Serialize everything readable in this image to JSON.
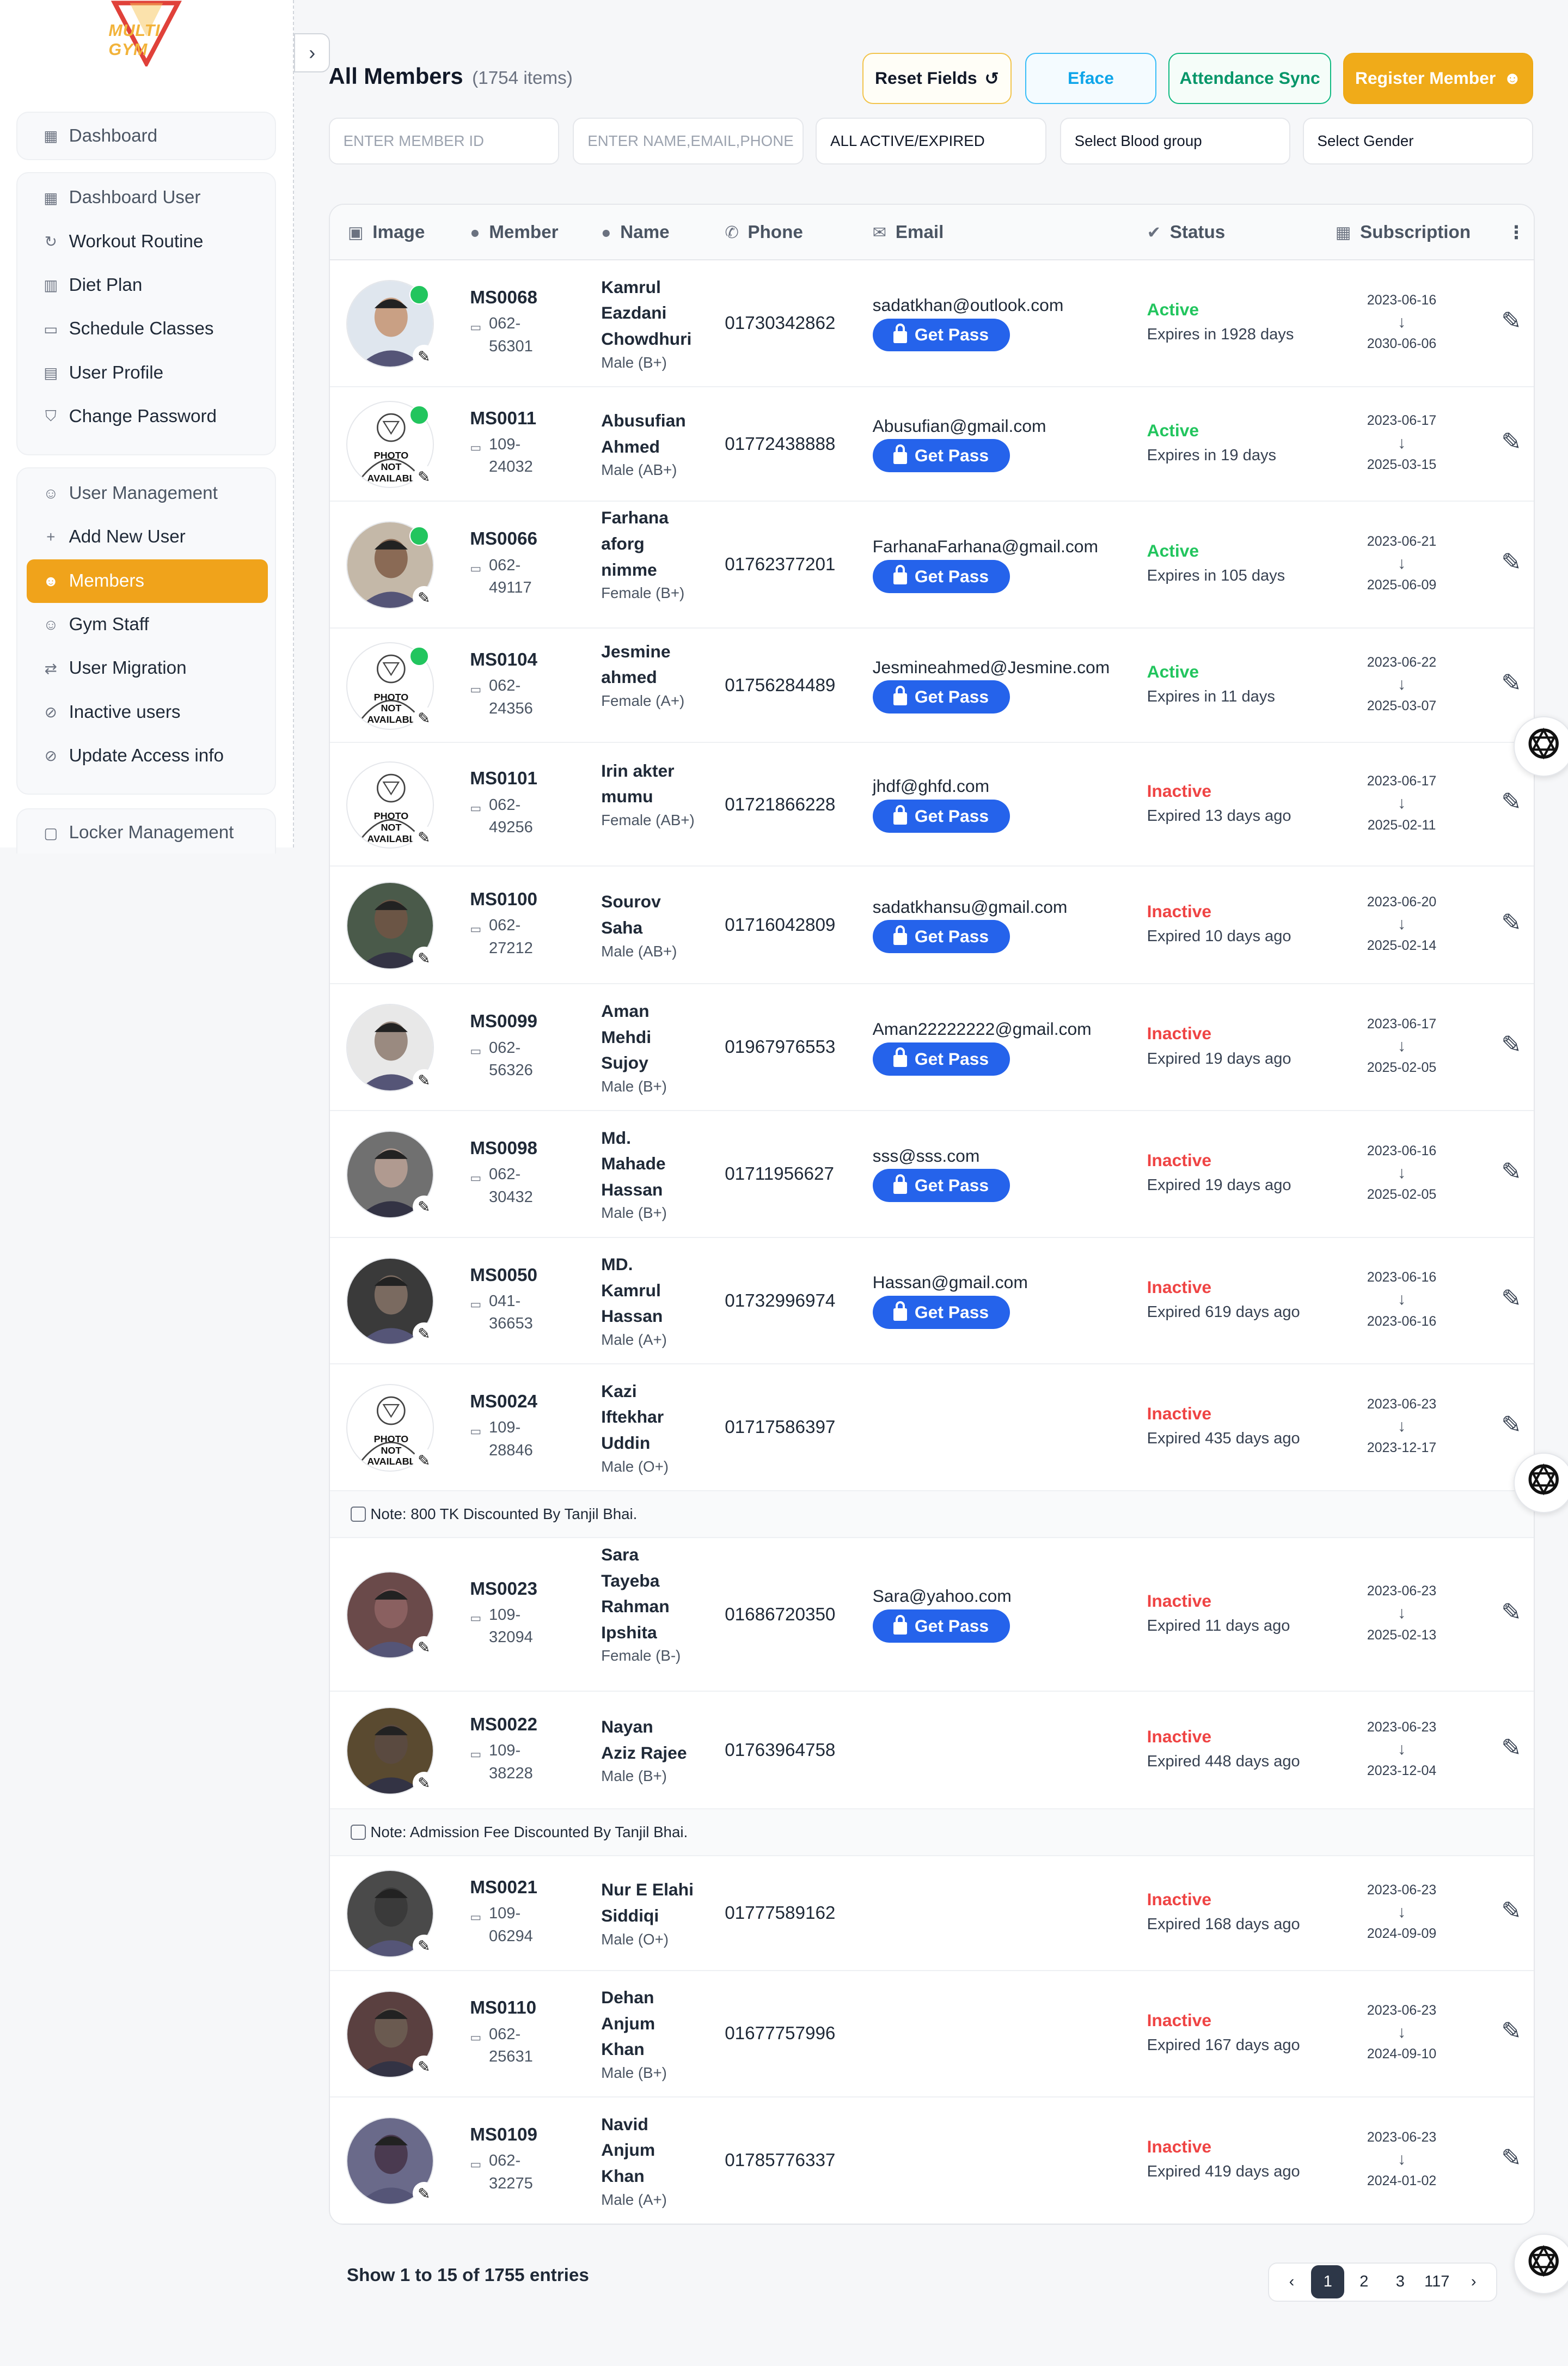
{
  "brand": {
    "logo_text": "MULTI GYM"
  },
  "sidebar": {
    "dashboard": "Dashboard",
    "group1": [
      "Dashboard User",
      "Workout Routine",
      "Diet Plan",
      "Schedule Classes",
      "User Profile",
      "Change Password"
    ],
    "group2": [
      "User Management",
      "Add New User",
      "Members",
      "Gym Staff",
      "User Migration",
      "Inactive users",
      "Update Access info"
    ],
    "locker": "Locker Management"
  },
  "header": {
    "title": "All Members",
    "count": "(1754 items)",
    "reset": "Reset Fields",
    "eface": "Eface",
    "sync": "Attendance Sync",
    "register": "Register Member"
  },
  "filters": {
    "member_id": "ENTER MEMBER ID",
    "name": "ENTER NAME,EMAIL,PHONE",
    "status": "ALL ACTIVE/EXPIRED",
    "blood": "Select Blood group",
    "gender": "Select Gender"
  },
  "columns": [
    "Image",
    "Member",
    "Name",
    "Phone",
    "Email",
    "Status",
    "Subscription"
  ],
  "get_pass_label": "Get Pass",
  "photo_na": [
    "PHOTO",
    "NOT",
    "AVAILABL"
  ],
  "rows": [
    {
      "id": "MS0068",
      "card1": "062-",
      "card2": "56301",
      "name": [
        "Kamrul",
        "Eazdani",
        "Chowdhuri"
      ],
      "gender": "Male (B+)",
      "phone": "01730342862",
      "email": "sadatkhan@outlook.com",
      "status": "Active",
      "expiry": "Expires in 1928 days",
      "start": "2023-06-16",
      "end": "2030-06-06"
    },
    {
      "id": "MS0011",
      "card1": "109-",
      "card2": "24032",
      "name": [
        "Abusufian",
        "Ahmed"
      ],
      "gender": "Male (AB+)",
      "phone": "01772438888",
      "email": "Abusufian@gmail.com",
      "status": "Active",
      "expiry": "Expires in 19 days",
      "start": "2023-06-17",
      "end": "2025-03-15"
    },
    {
      "id": "MS0066",
      "card1": "062-",
      "card2": "49117",
      "name": [
        "Farhana",
        "aforg",
        "nimme"
      ],
      "gender": "Female (B+)",
      "phone": "01762377201",
      "email": "FarhanaFarhana@gmail.com",
      "status": "Active",
      "expiry": "Expires in 105 days",
      "start": "2023-06-21",
      "end": "2025-06-09"
    },
    {
      "id": "MS0104",
      "card1": "062-",
      "card2": "24356",
      "name": [
        "Jesmine",
        "ahmed"
      ],
      "gender": "Female (A+)",
      "phone": "01756284489",
      "email": "Jesmineahmed@Jesmine.com",
      "status": "Active",
      "expiry": "Expires in 11 days",
      "start": "2023-06-22",
      "end": "2025-03-07"
    },
    {
      "id": "MS0101",
      "card1": "062-",
      "card2": "49256",
      "name": [
        "Irin akter",
        "mumu"
      ],
      "gender": "Female (AB+)",
      "phone": "01721866228",
      "email": "jhdf@ghfd.com",
      "status": "Inactive",
      "expiry": "Expired 13 days ago",
      "start": "2023-06-17",
      "end": "2025-02-11"
    },
    {
      "id": "MS0100",
      "card1": "062-",
      "card2": "27212",
      "name": [
        "Sourov",
        "Saha"
      ],
      "gender": "Male (AB+)",
      "phone": "01716042809",
      "email": "sadatkhansu@gmail.com",
      "status": "Inactive",
      "expiry": "Expired 10 days ago",
      "start": "2023-06-20",
      "end": "2025-02-14"
    },
    {
      "id": "MS0099",
      "card1": "062-",
      "card2": "56326",
      "name": [
        "Aman",
        "Mehdi",
        "Sujoy"
      ],
      "gender": "Male (B+)",
      "phone": "01967976553",
      "email": "Aman22222222@gmail.com",
      "status": "Inactive",
      "expiry": "Expired 19 days ago",
      "start": "2023-06-17",
      "end": "2025-02-05"
    },
    {
      "id": "MS0098",
      "card1": "062-",
      "card2": "30432",
      "name": [
        "Md.",
        "Mahade",
        "Hassan"
      ],
      "gender": "Male (B+)",
      "phone": "01711956627",
      "email": "sss@sss.com",
      "status": "Inactive",
      "expiry": "Expired 19 days ago",
      "start": "2023-06-16",
      "end": "2025-02-05"
    },
    {
      "id": "MS0050",
      "card1": "041-",
      "card2": "36653",
      "name": [
        "MD.",
        "Kamrul",
        "Hassan"
      ],
      "gender": "Male (A+)",
      "phone": "01732996974",
      "email": "Hassan@gmail.com",
      "status": "Inactive",
      "expiry": "Expired 619 days ago",
      "start": "2023-06-16",
      "end": "2023-06-16"
    },
    {
      "id": "MS0024",
      "card1": "109-",
      "card2": "28846",
      "name": [
        "Kazi",
        "Iftekhar",
        "Uddin"
      ],
      "gender": "Male (O+)",
      "phone": "01717586397",
      "email": "",
      "status": "Inactive",
      "expiry": "Expired 435 days ago",
      "start": "2023-06-23",
      "end": "2023-12-17"
    },
    {
      "id": "MS0023",
      "card1": "109-",
      "card2": "32094",
      "name": [
        "Sara",
        "Tayeba",
        "Rahman",
        "Ipshita"
      ],
      "gender": "Female (B-)",
      "phone": "01686720350",
      "email": "Sara@yahoo.com",
      "status": "Inactive",
      "expiry": "Expired 11 days ago",
      "start": "2023-06-23",
      "end": "2025-02-13"
    },
    {
      "id": "MS0022",
      "card1": "109-",
      "card2": "38228",
      "name": [
        "Nayan",
        "Aziz Rajee"
      ],
      "gender": "Male (B+)",
      "phone": "01763964758",
      "email": "",
      "status": "Inactive",
      "expiry": "Expired 448 days ago",
      "start": "2023-06-23",
      "end": "2023-12-04"
    },
    {
      "id": "MS0021",
      "card1": "109-",
      "card2": "06294",
      "name": [
        "Nur E Elahi",
        "Siddiqi"
      ],
      "gender": "Male (O+)",
      "phone": "01777589162",
      "email": "",
      "status": "Inactive",
      "expiry": "Expired 168 days ago",
      "start": "2023-06-23",
      "end": "2024-09-09"
    },
    {
      "id": "MS0110",
      "card1": "062-",
      "card2": "25631",
      "name": [
        "Dehan",
        "Anjum",
        "Khan"
      ],
      "gender": "Male (B+)",
      "phone": "01677757996",
      "email": "",
      "status": "Inactive",
      "expiry": "Expired 167 days ago",
      "start": "2023-06-23",
      "end": "2024-09-10"
    },
    {
      "id": "MS0109",
      "card1": "062-",
      "card2": "32275",
      "name": [
        "Navid",
        "Anjum",
        "Khan"
      ],
      "gender": "Male (A+)",
      "phone": "01785776337",
      "email": "",
      "status": "Inactive",
      "expiry": "Expired 419 days ago",
      "start": "2023-06-23",
      "end": "2024-01-02"
    }
  ],
  "notes": [
    "Note: 800 TK Discounted By Tanjil Bhai.",
    "Note: Admission Fee Discounted By Tanjil Bhai."
  ],
  "footer": {
    "entries": "Show 1 to 15 of 1755 entries",
    "pages": [
      "1",
      "2",
      "3",
      "117"
    ],
    "prev": "‹",
    "next": "›"
  },
  "colors": {
    "accent": "#f0a31b",
    "primary": "#2563eb",
    "active": "#22c55e",
    "inactive": "#ef4444"
  }
}
